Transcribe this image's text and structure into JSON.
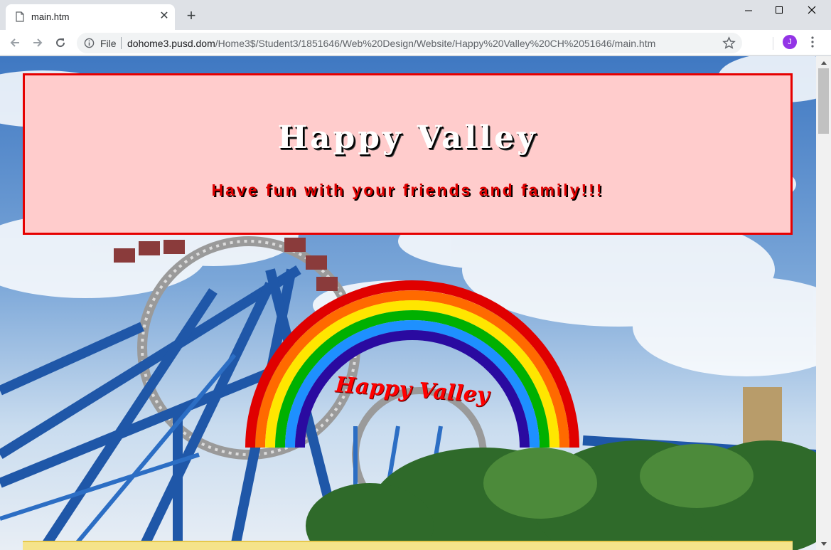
{
  "browser": {
    "tab": {
      "title": "main.htm",
      "icon": "page-icon",
      "close_icon": "close-icon"
    },
    "new_tab_icon": "plus-icon",
    "window_controls": [
      "minimize-icon",
      "maximize-icon",
      "close-icon"
    ],
    "toolbar": {
      "back_icon": "back-arrow-icon",
      "forward_icon": "forward-arrow-icon",
      "reload_icon": "reload-icon",
      "security_label": "File",
      "url_host": "dohome3.pusd.dom",
      "url_path": "/Home3$/Student3/1851646/Web%20Design/Website/Happy%20Valley%20CH%2051646/main.htm",
      "bookmark_icon": "star-icon",
      "profile_initial": "J",
      "menu_icon": "kebab-menu-icon"
    }
  },
  "page": {
    "header": {
      "title": "Happy Valley",
      "tagline": "Have fun with your friends and family!!!"
    },
    "rainbow_label": "Happy Valley",
    "colors": {
      "header_bg": "#ffcccc",
      "header_border": "#e60000",
      "tagline": "#e00000",
      "rainbow": [
        "#e00000",
        "#ff6a00",
        "#ffe600",
        "#00b000",
        "#1e90ff",
        "#2a0aa0"
      ]
    }
  }
}
